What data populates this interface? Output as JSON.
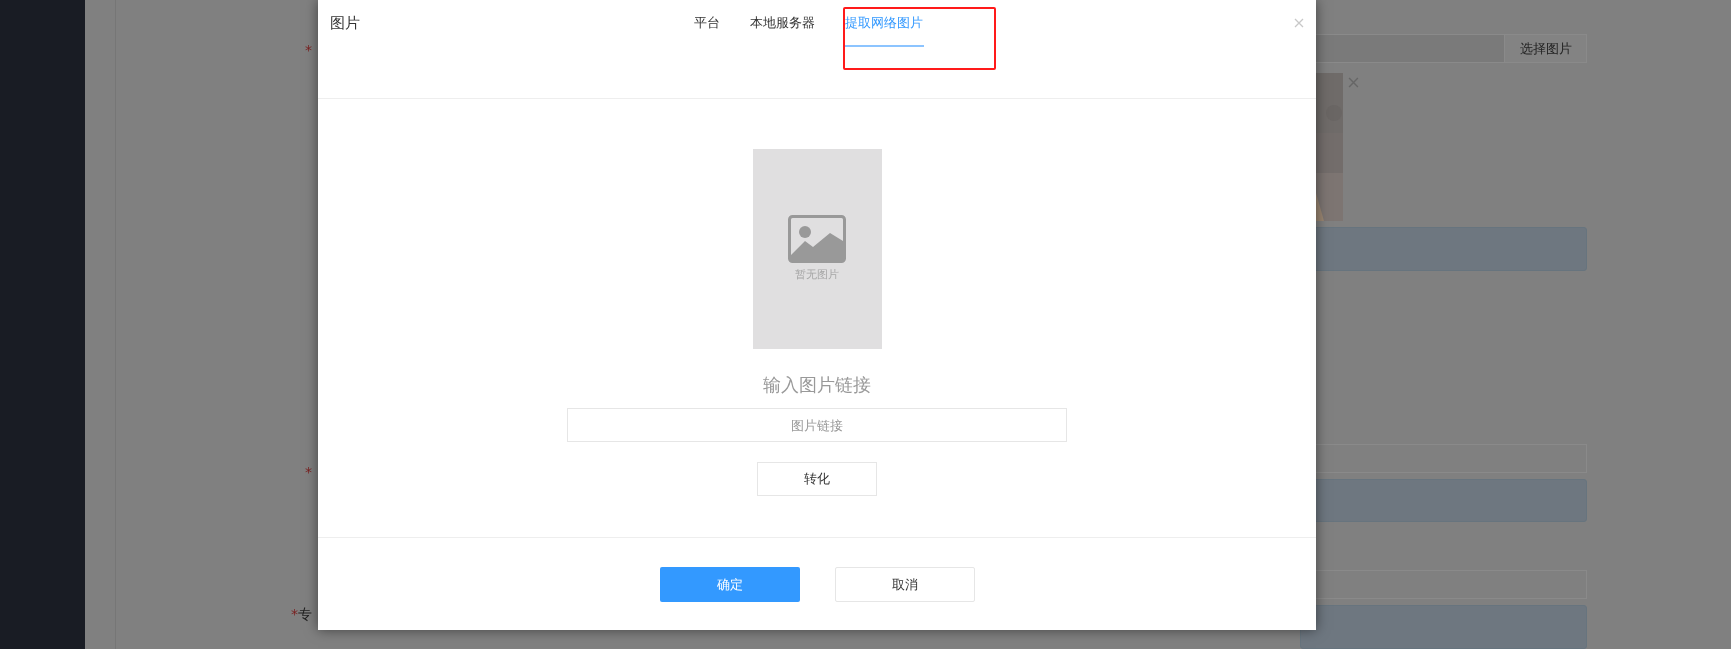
{
  "background": {
    "labels": [
      {
        "mark": "*"
      },
      {
        "mark": "*"
      },
      {
        "mark": "*",
        "text": "专"
      }
    ],
    "select_button": "选择图片"
  },
  "dialog": {
    "title": "图片",
    "tabs": [
      {
        "label": "平台",
        "selected": false
      },
      {
        "label": "本地服务器",
        "selected": false
      },
      {
        "label": "提取网络图片",
        "selected": true
      }
    ],
    "preview": {
      "empty_text": "暂无图片"
    },
    "prompt": "输入图片链接",
    "url_field": {
      "placeholder": "图片链接"
    },
    "convert_button": "转化",
    "buttons": [
      {
        "label": "确定",
        "kind": "primary"
      },
      {
        "label": "取消",
        "kind": "default"
      }
    ]
  }
}
